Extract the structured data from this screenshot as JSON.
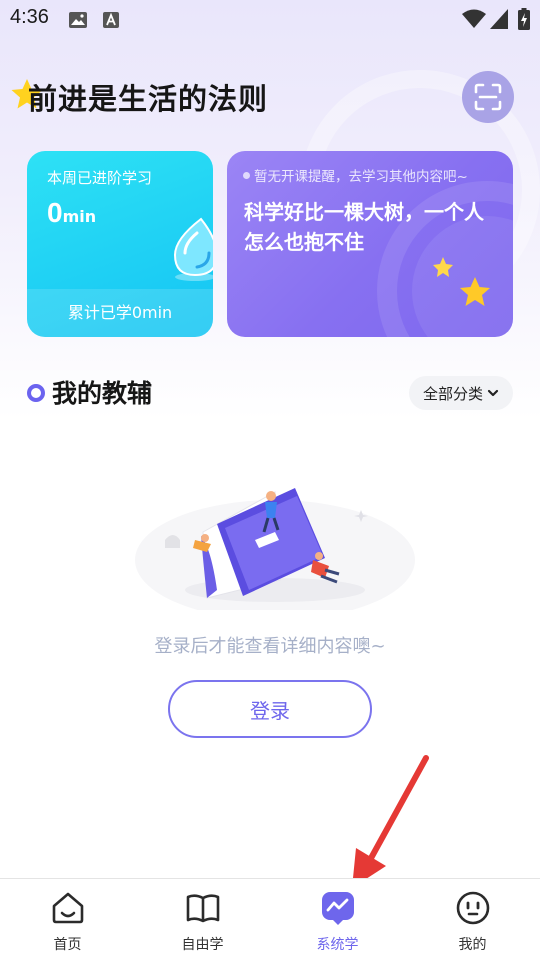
{
  "status_bar": {
    "time": "4:36"
  },
  "header": {
    "headline": "前进是生活的法则"
  },
  "weekly_card": {
    "label": "本周已进阶学习",
    "value": "0",
    "unit": "min",
    "total_label": "累计已学0min"
  },
  "reminder_card": {
    "reminder": "暂无开课提醒，去学习其他内容吧~",
    "quote": "科学好比一棵大树，一个人怎么也抱不住"
  },
  "section": {
    "title": "我的教辅",
    "category_label": "全部分类"
  },
  "empty_state": {
    "message": "登录后才能查看详细内容噢~",
    "login_label": "登录"
  },
  "bottom_nav": {
    "items": [
      {
        "label": "首页",
        "icon": "home-icon"
      },
      {
        "label": "自由学",
        "icon": "book-icon"
      },
      {
        "label": "系统学",
        "icon": "chart-icon",
        "active": true
      },
      {
        "label": "我的",
        "icon": "profile-icon"
      }
    ]
  },
  "colors": {
    "accent": "#6e66ec",
    "card_blue": "#14c4f3",
    "card_purple": "#8770f1",
    "annotation_arrow": "#e53935"
  }
}
